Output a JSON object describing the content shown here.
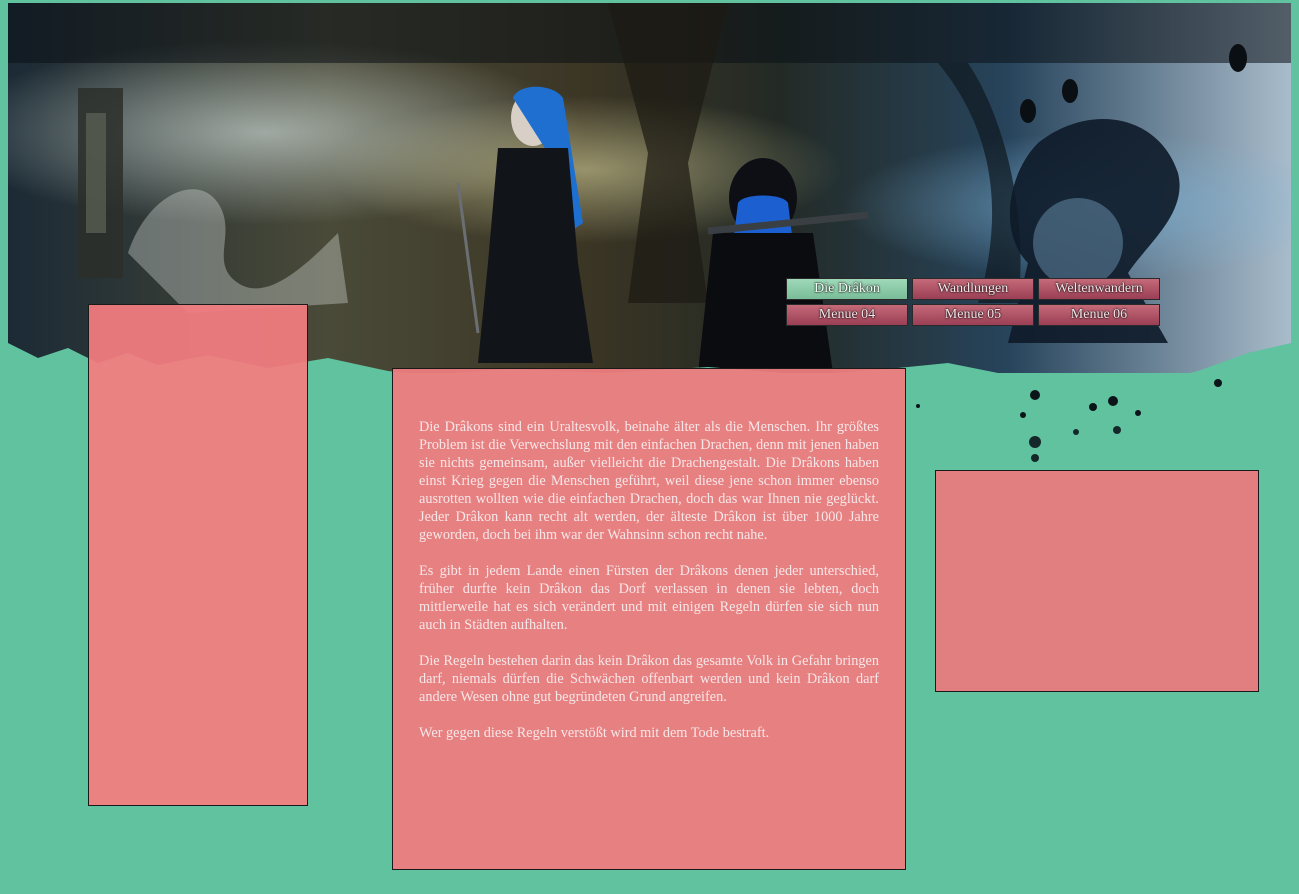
{
  "nav": {
    "items": [
      {
        "label": "Die Drâkon"
      },
      {
        "label": "Wandlungen"
      },
      {
        "label": "Weltenwandern"
      },
      {
        "label": "Menue 04"
      },
      {
        "label": "Menue 05"
      },
      {
        "label": "Menue 06"
      }
    ]
  },
  "main": {
    "paragraphs": [
      "Die Drâkons sind ein Uraltesvolk, beinahe älter als die Menschen. Ihr größtes Problem ist die Verwechslung mit den einfachen Drachen, denn mit jenen haben sie nichts gemeinsam, außer vielleicht die Drachengestalt. Die Drâkons haben einst Krieg gegen die Menschen geführt, weil diese jene schon immer ebenso ausrotten wollten wie die einfachen Drachen, doch das war Ihnen nie geglückt. Jeder Drâkon kann recht alt werden, der älteste Drâkon ist über 1000 Jahre geworden, doch bei ihm war der Wahnsinn schon recht nahe.",
      "Es gibt in jedem Lande einen Fürsten der Drâkons denen jeder unterschied, früher durfte kein Drâkon das Dorf verlassen in denen sie lebten, doch mittlerweile hat es sich verändert und mit einigen Regeln dürfen sie sich nun auch in Städten aufhalten.",
      "Die Regeln bestehen darin das kein Drâkon das gesamte Volk in Gefahr bringen darf, niemals dürfen die Schwächen offenbart werden und kein Drâkon darf andere Wesen ohne gut begründeten Grund angreifen.",
      "Wer gegen diese Regeln verstößt wird mit dem Tode bestraft."
    ]
  },
  "colors": {
    "page_bg": "#60c29e",
    "box_bg": "#e07e80",
    "text": "#f7e6e8",
    "nav_active": "#8fcfae",
    "nav_pink": "#b05468"
  },
  "icons": [
    "banner-artwork-image"
  ]
}
